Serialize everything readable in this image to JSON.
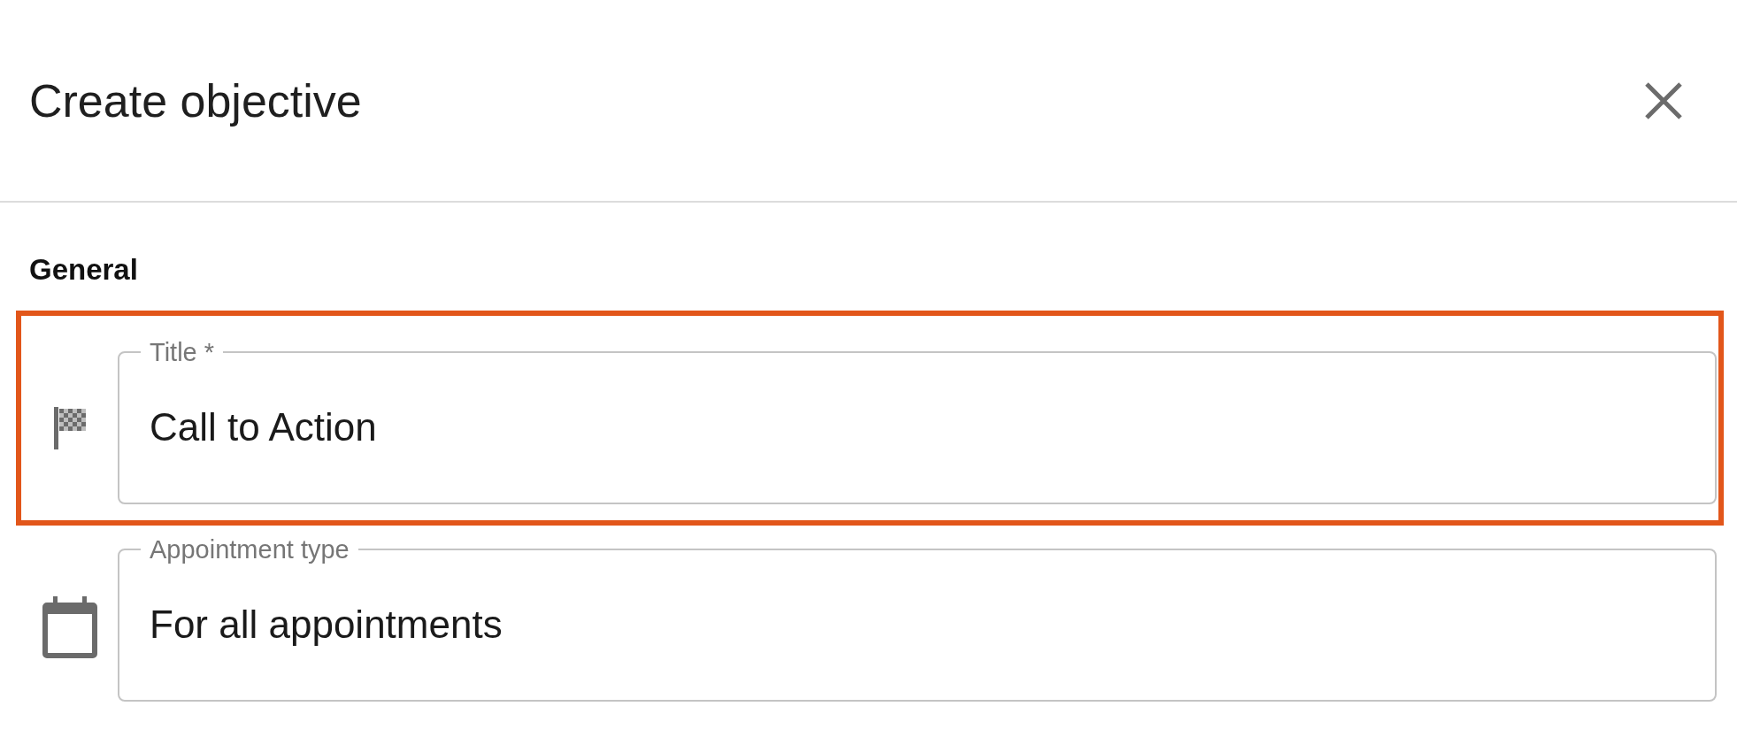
{
  "dialog": {
    "title": "Create objective"
  },
  "section": {
    "heading": "General"
  },
  "fields": [
    {
      "label": "Title *",
      "value": "Call to Action",
      "kind": "flag",
      "highlighted": true
    },
    {
      "label": "Appointment type",
      "value": "For all appointments",
      "kind": "calendar",
      "highlighted": false
    }
  ]
}
